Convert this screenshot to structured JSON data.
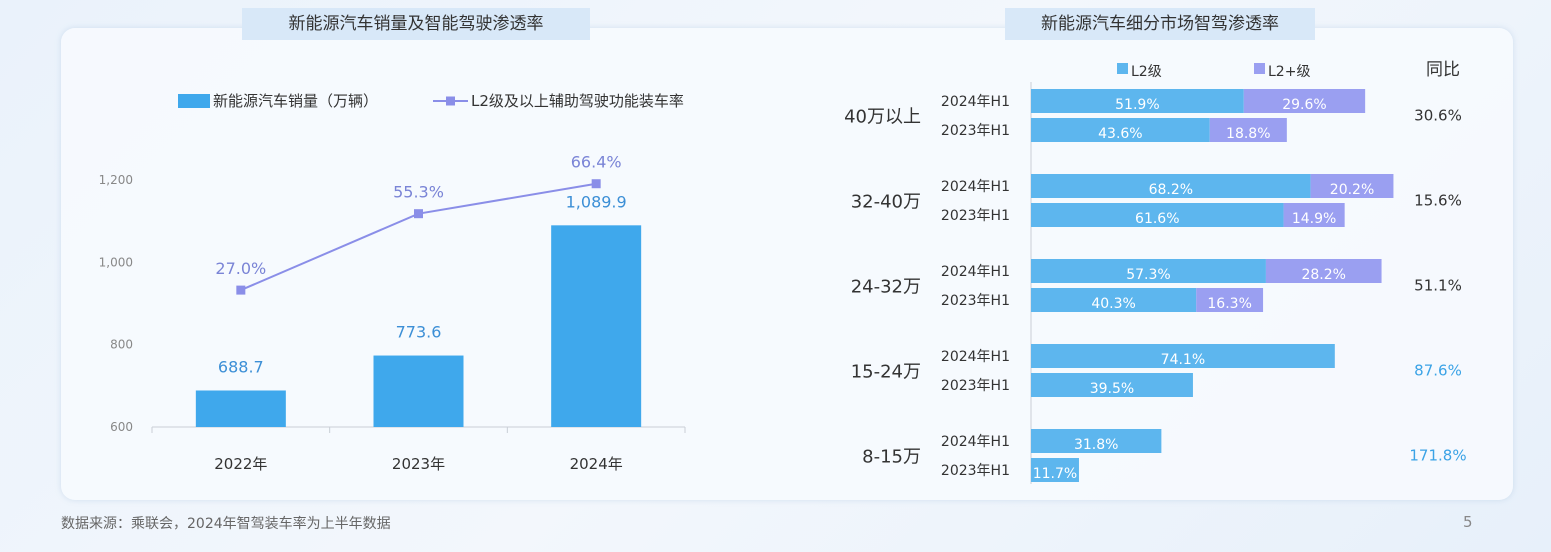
{
  "page": {
    "left_title": "新能源汽车销量及智能驾驶渗透率",
    "right_title": "新能源汽车细分市场智驾渗透率",
    "footer": "数据来源：乘联会，2024年智驾装车率为上半年数据",
    "page_number": "5"
  },
  "colors": {
    "bar": "#3fa8ec",
    "line": "#8a8ee8",
    "l2": "#5db6ee",
    "l2plus": "#9a9ff1",
    "yoy_highlight": "#3ba3e6"
  },
  "chart_data": [
    {
      "type": "bar",
      "title": "新能源汽车销量及智能驾驶渗透率",
      "categories": [
        "2022年",
        "2023年",
        "2024年"
      ],
      "series": [
        {
          "name": "新能源汽车销量（万辆）",
          "type": "bar",
          "values": [
            688.7,
            773.6,
            1089.9
          ],
          "labels": [
            "688.7",
            "773.6",
            "1,089.9"
          ]
        },
        {
          "name": "L2级及以上辅助驾驶功能装车率",
          "type": "line",
          "values": [
            27.0,
            55.3,
            66.4
          ],
          "labels": [
            "27.0%",
            "55.3%",
            "66.4%"
          ]
        }
      ],
      "ylim": [
        600,
        1200
      ],
      "yticks": [
        600,
        800,
        1000,
        1200
      ],
      "ytick_labels": [
        "600",
        "800",
        "1,000",
        "1,200"
      ],
      "legend_position": "top-left"
    },
    {
      "type": "bar",
      "orientation": "horizontal",
      "stacked": true,
      "title": "新能源汽车细分市场智驾渗透率",
      "legend": [
        "L2级",
        "L2+级"
      ],
      "yoy_header": "同比",
      "groups": [
        {
          "name": "40万以上",
          "yoy": "30.6%",
          "highlight": false,
          "rows": [
            {
              "label": "2024年H1",
              "l2": 51.9,
              "l2plus": 29.6
            },
            {
              "label": "2023年H1",
              "l2": 43.6,
              "l2plus": 18.8
            }
          ]
        },
        {
          "name": "32-40万",
          "yoy": "15.6%",
          "highlight": false,
          "rows": [
            {
              "label": "2024年H1",
              "l2": 68.2,
              "l2plus": 20.2
            },
            {
              "label": "2023年H1",
              "l2": 61.6,
              "l2plus": 14.9
            }
          ]
        },
        {
          "name": "24-32万",
          "yoy": "51.1%",
          "highlight": false,
          "rows": [
            {
              "label": "2024年H1",
              "l2": 57.3,
              "l2plus": 28.2
            },
            {
              "label": "2023年H1",
              "l2": 40.3,
              "l2plus": 16.3
            }
          ]
        },
        {
          "name": "15-24万",
          "yoy": "87.6%",
          "highlight": true,
          "rows": [
            {
              "label": "2024年H1",
              "l2": 74.1,
              "l2plus": 0
            },
            {
              "label": "2023年H1",
              "l2": 39.5,
              "l2plus": 0
            }
          ]
        },
        {
          "name": "8-15万",
          "yoy": "171.8%",
          "highlight": true,
          "rows": [
            {
              "label": "2024年H1",
              "l2": 31.8,
              "l2plus": 0
            },
            {
              "label": "2023年H1",
              "l2": 11.7,
              "l2plus": 0
            }
          ]
        }
      ]
    }
  ]
}
